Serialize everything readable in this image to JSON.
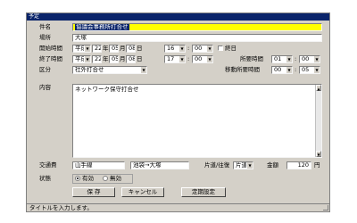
{
  "window": {
    "title": "予定"
  },
  "subject": {
    "label": "件名",
    "value": "協議会事務所打合せ"
  },
  "place": {
    "label": "場所",
    "value": "大塚"
  },
  "start": {
    "label": "開始時間",
    "era": "平成",
    "year": "22",
    "year_unit": "年",
    "month": "05",
    "month_unit": "月",
    "day": "08",
    "day_unit": "日",
    "hour": "16",
    "minute": "00",
    "allday_label": "終日"
  },
  "end": {
    "label": "終了時間",
    "era": "平成",
    "year": "22",
    "year_unit": "年",
    "month": "05",
    "month_unit": "月",
    "day": "08",
    "day_unit": "日",
    "hour": "17",
    "minute": "00"
  },
  "duration": {
    "label": "所要時間",
    "hour": "01",
    "minute": "00"
  },
  "category": {
    "label": "区分",
    "value": "社外打合せ"
  },
  "travel": {
    "label": "移動所要時間",
    "hour": "00",
    "minute": "05"
  },
  "content": {
    "label": "内容",
    "value": "ネットワーク保守打合せ"
  },
  "fare": {
    "label": "交通費",
    "line": "山手線",
    "route": "池袋→大塚",
    "trip_label": "片道/往復",
    "trip_value": "片道",
    "amount_label": "金額",
    "amount": "120",
    "unit": "円"
  },
  "state": {
    "label": "状態",
    "valid": "有効",
    "invalid": "無効"
  },
  "buttons": {
    "save": "保 存",
    "cancel": "キャンセル",
    "recurring": "定期設定"
  },
  "status": {
    "text": "タイトルを入力します。"
  },
  "colors": {
    "title_bg": "#0a246a",
    "highlight": "#ffff00",
    "face": "#d4d0c8"
  }
}
